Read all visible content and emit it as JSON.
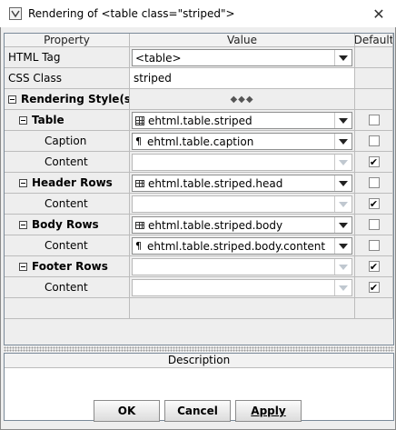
{
  "window": {
    "title": "Rendering of <table class=\"striped\">",
    "close_glyph": "✕"
  },
  "table": {
    "headers": {
      "property": "Property",
      "value": "Value",
      "default": "Default"
    }
  },
  "rows": {
    "html_tag": {
      "label": "HTML Tag",
      "value": "<table>"
    },
    "css_class": {
      "label": "CSS Class",
      "value": "striped"
    },
    "rendering_style": {
      "label": "Rendering Style(s)",
      "value": "◆◆◆"
    },
    "table": {
      "label": "Table",
      "value": "ehtml.table.striped",
      "default": false
    },
    "caption": {
      "label": "Caption",
      "value": "ehtml.table.caption",
      "default": false
    },
    "table_content": {
      "label": "Content",
      "value": "",
      "default": true
    },
    "header_rows": {
      "label": "Header Rows",
      "value": "ehtml.table.striped.head",
      "default": false
    },
    "header_content": {
      "label": "Content",
      "value": "",
      "default": true
    },
    "body_rows": {
      "label": "Body Rows",
      "value": "ehtml.table.striped.body",
      "default": false
    },
    "body_content": {
      "label": "Content",
      "value": "ehtml.table.striped.body.content",
      "default": false
    },
    "footer_rows": {
      "label": "Footer Rows",
      "value": "",
      "default": true
    },
    "footer_content": {
      "label": "Content",
      "value": "",
      "default": true
    }
  },
  "description": {
    "header": "Description"
  },
  "buttons": {
    "ok": "OK",
    "cancel": "Cancel",
    "apply": "Apply"
  },
  "icons": {
    "check": "✔",
    "paragraph": "¶"
  }
}
